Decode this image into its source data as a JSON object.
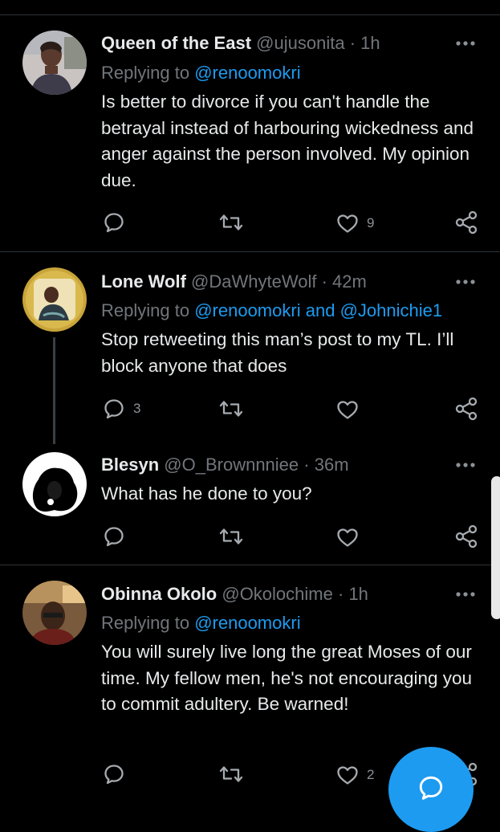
{
  "colors": {
    "background": "#000000",
    "text": "#e7e9ea",
    "muted": "#71767b",
    "accent": "#1d9bf0",
    "divider": "#2f3336"
  },
  "icons": {
    "reply": "speech-bubble-icon",
    "retweet": "retweet-arrows-icon",
    "like": "heart-outline-icon",
    "share": "share-nodes-icon",
    "more": "three-dots-icon",
    "compose": "compose-bubble-icon"
  },
  "tweets": [
    {
      "name": "Queen of the East",
      "handle": "@ujusonita",
      "separator": "·",
      "time": "1h",
      "replying_prefix": "Replying to",
      "replying_to": "@renoomokri",
      "replying_and": "",
      "replying_to_2": "",
      "text": "Is better to divorce if you can't handle the betrayal instead of harbouring wickedness and anger against the person involved. My opinion due.",
      "reply_count": "",
      "retweet_count": "",
      "like_count": "9"
    },
    {
      "name": "Lone Wolf",
      "handle": "@DaWhyteWolf",
      "separator": "·",
      "time": "42m",
      "replying_prefix": "Replying to",
      "replying_to": "@renoomokri",
      "replying_and": "and",
      "replying_to_2": "@Johnichie1",
      "text": "Stop retweeting this man’s post to my TL. I’ll block anyone that does",
      "reply_count": "3",
      "retweet_count": "",
      "like_count": ""
    },
    {
      "name": "Blesyn",
      "handle": "@O_Brownnniee",
      "separator": "·",
      "time": "36m",
      "replying_prefix": "",
      "replying_to": "",
      "replying_and": "",
      "replying_to_2": "",
      "text": "What has he done to you?",
      "reply_count": "",
      "retweet_count": "",
      "like_count": ""
    },
    {
      "name": "Obinna Okolo",
      "handle": "@Okolochime",
      "separator": "·",
      "time": "1h",
      "replying_prefix": "Replying to",
      "replying_to": "@renoomokri",
      "replying_and": "",
      "replying_to_2": "",
      "text": "You will surely live long the great Moses of our time. My fellow men, he's not encouraging you to commit adultery. Be warned!",
      "reply_count": "",
      "retweet_count": "",
      "like_count": "2"
    }
  ]
}
